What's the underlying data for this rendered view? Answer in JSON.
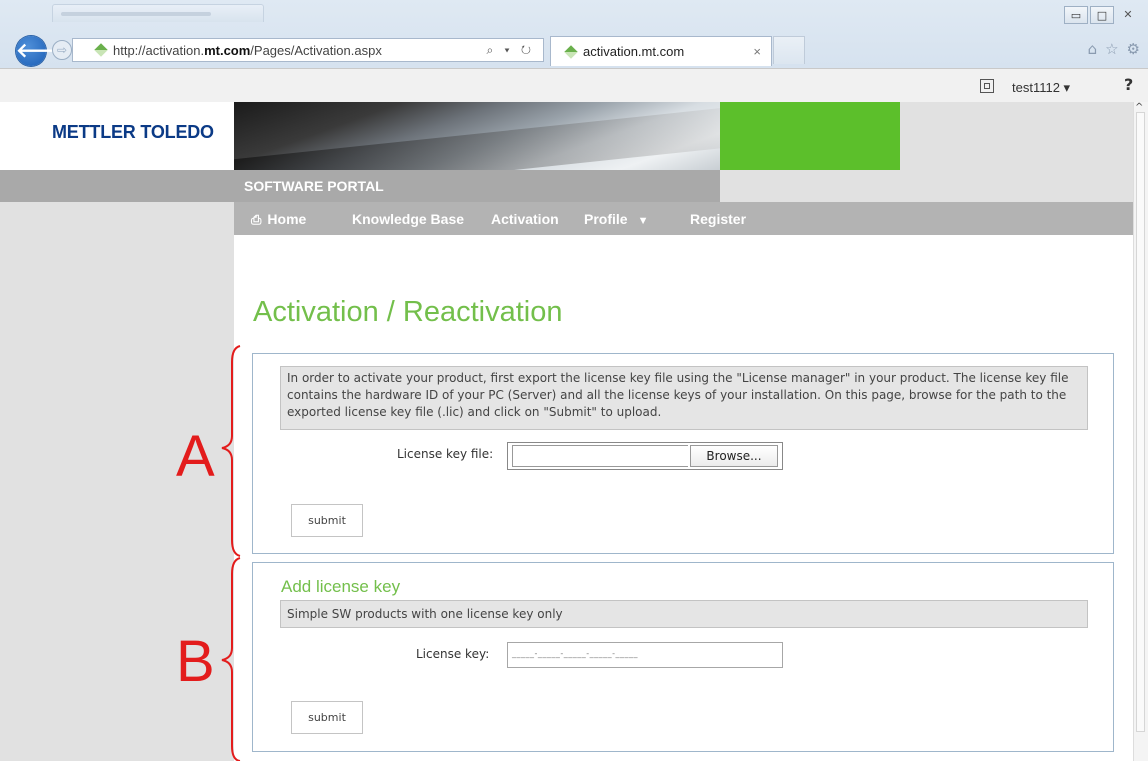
{
  "browser": {
    "address_url_prefix": "http://activation.",
    "address_url_domain": "mt.com",
    "address_url_suffix": "/Pages/Activation.aspx",
    "address_tools": "⌕ ▾ ↻",
    "tab_title": "activation.mt.com",
    "tab_close": "×",
    "window_controls": [
      "▭",
      "□",
      "✕"
    ],
    "chrome_right_icons": [
      "⌂",
      "☆",
      "⚙"
    ]
  },
  "suite_bar": {
    "user": "test1112 ▾",
    "help": "?"
  },
  "header": {
    "logo_text": "METTLER TOLEDO",
    "portal_title": "SOFTWARE PORTAL"
  },
  "nav": {
    "items": [
      {
        "label": "Home",
        "icon": "home-icon"
      },
      {
        "label": "Knowledge Base"
      },
      {
        "label": "Activation"
      },
      {
        "label": "Profile",
        "dropdown": "▼"
      },
      {
        "label": "Register"
      }
    ]
  },
  "main": {
    "title": "Activation / Reactivation",
    "section_a": {
      "info_text": "In order to activate your product, first export the license key file using the \"License manager\" in your product. The license key file contains the hardware ID of your PC (Server) and all the license keys of your installation. On this page, browse for the path to the exported license key file (.lic) and click on \"Submit\" to upload.",
      "file_label": "License key file:",
      "browse_label": "Browse...",
      "submit_label": "submit"
    },
    "section_b": {
      "title": "Add license key",
      "info_text": "Simple SW products with one license key only",
      "key_label": "License key:",
      "key_placeholder": "_____-_____-_____-_____-_____",
      "submit_label": "submit"
    }
  },
  "annotations": {
    "a": "A",
    "b": "B",
    "color": "#e31c1c"
  },
  "colors": {
    "accent_green": "#73bf4b",
    "banner_green": "#5cbf2b",
    "logo_blue": "#0b3a86"
  }
}
